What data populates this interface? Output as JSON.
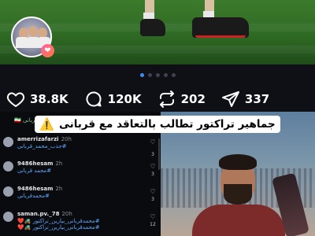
{
  "post": {
    "slide_count": 5,
    "active_slide": 1
  },
  "stats": {
    "likes": "38.8K",
    "comments": "120K",
    "reposts": "202",
    "shares": "337"
  },
  "banner": {
    "text": "جماهیر تراکتور تطالب بالتعاقد مع قربانی",
    "icon": "warning-icon"
  },
  "media_comments": {
    "top_snippet": "قربانی 🇮🇷",
    "items": [
      {
        "user": "amerrizafarzi",
        "time": "20h",
        "text": "#جذب_محمد_قربانی",
        "count": "3"
      },
      {
        "user": "9486hesam",
        "time": "2h",
        "text": "#محمد قربانی",
        "count": "3"
      },
      {
        "user": "9486hesam",
        "time": "2h",
        "text": "#محمدقربانی",
        "count": "3"
      },
      {
        "user": "saman.pv._78",
        "time": "20h",
        "text": "#محمدقربانی_بیارین_تراکتور 🚜❤️",
        "text2": "#محمدقربانی_بیارین_تراکتور 🚜❤️",
        "count": "12"
      }
    ]
  },
  "colors": {
    "background": "#0e1016",
    "accent": "#3b8ef0",
    "hashtag": "#5fa8ff",
    "heart_badge": "#ff5fa8"
  }
}
